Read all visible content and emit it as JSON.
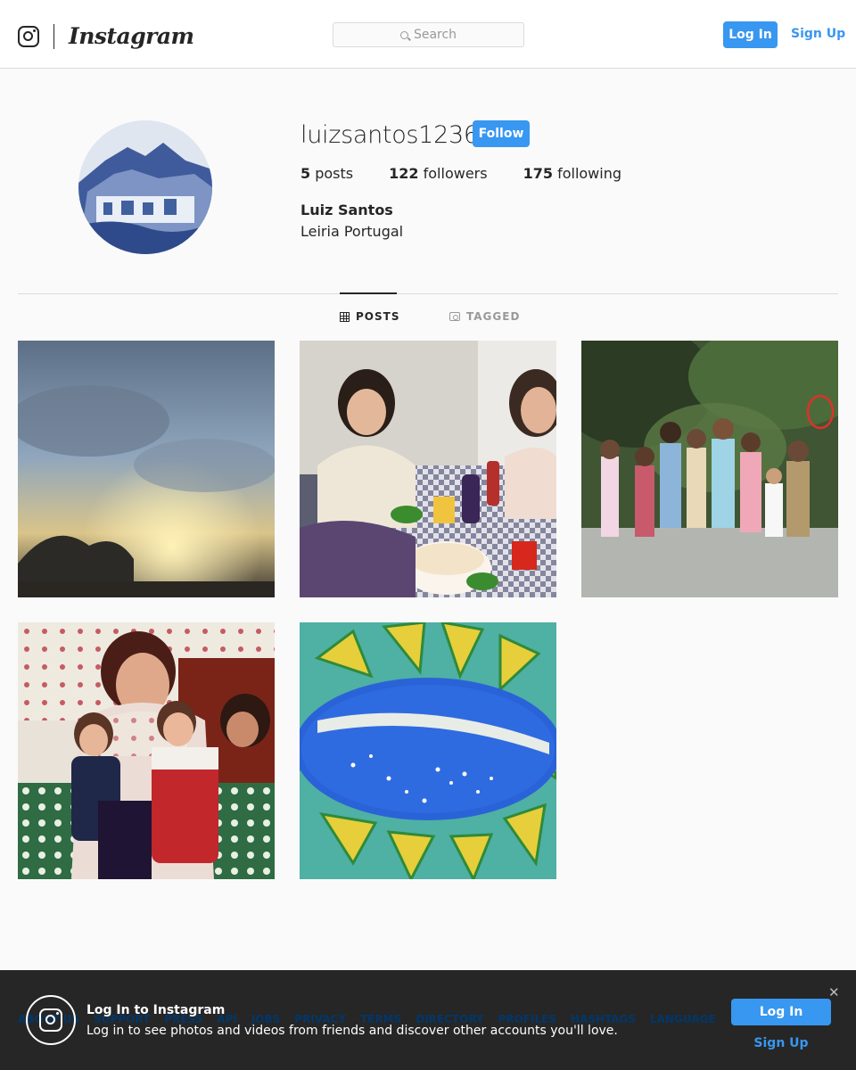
{
  "nav": {
    "logo_icon": "instagram-glyph-icon",
    "wordmark": "Instagram",
    "search_placeholder": "Search",
    "login_label": "Log In",
    "signup_label": "Sign Up"
  },
  "profile": {
    "username": "luizsantos1236",
    "follow_label": "Follow",
    "posts_count": "5",
    "posts_label": "posts",
    "followers_count": "122",
    "followers_label": "followers",
    "following_count": "175",
    "following_label": "following",
    "full_name": "Luiz Santos",
    "bio": "Leiria Portugal"
  },
  "tabs": [
    {
      "label": "POSTS",
      "icon": "grid-icon",
      "active": true
    },
    {
      "label": "TAGGED",
      "icon": "tag-icon",
      "active": false
    }
  ],
  "posts": [
    {
      "description": "cloudy sky at sunset"
    },
    {
      "description": "two women at a table with cake"
    },
    {
      "description": "group of children in a park"
    },
    {
      "description": "woman holding two toddlers"
    },
    {
      "description": "blue globe with stars"
    }
  ],
  "footer": {
    "links": [
      "ABOUT US",
      "SUPPORT",
      "PRESS",
      "API",
      "JOBS",
      "PRIVACY",
      "TERMS",
      "DIRECTORY",
      "PROFILES",
      "HASHTAGS",
      "LANGUAGE"
    ]
  },
  "banner": {
    "title": "Log In to Instagram",
    "text": "Log in to see photos and videos from friends and discover other accounts you'll love.",
    "close_glyph": "✕",
    "login_label": "Log In",
    "signup_label": "Sign Up"
  },
  "colors": {
    "accent": "#3897f0",
    "text": "#262626",
    "muted": "#999999",
    "background": "#fafafa"
  }
}
